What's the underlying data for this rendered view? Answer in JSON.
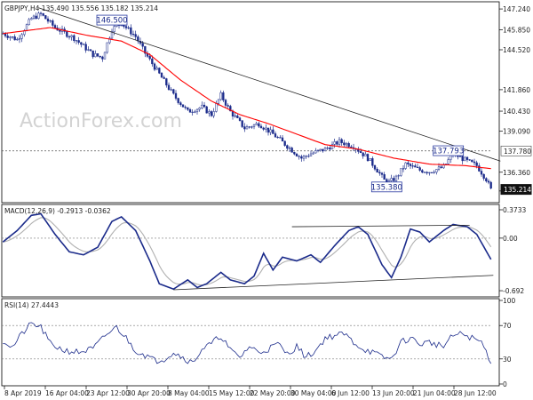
{
  "watermark": "ActionForex.com",
  "chart_data": [
    {
      "type": "candlestick",
      "panel": "price",
      "header": "GBPJPY,H4  135.490 135.556 135.182 135.214",
      "x_tick_labels": [
        "8 Apr 2019",
        "16 Apr 04:00",
        "23 Apr 12:00",
        "30 Apr 20:00",
        "8 May 04:00",
        "15 May 12:00",
        "22 May 20:00",
        "30 May 04:00",
        "6 Jun 12:00",
        "13 Jun 20:00",
        "21 Jun 04:00",
        "28 Jun 12:00"
      ],
      "y_tick_labels": [
        "147.240",
        "145.850",
        "144.520",
        "141.860",
        "140.430",
        "139.090",
        "136.360",
        "135.110"
      ],
      "y_ticks": [
        147.24,
        145.85,
        144.52,
        141.86,
        140.43,
        139.09,
        136.36,
        135.11
      ],
      "ylim": [
        134.45,
        147.6
      ],
      "last_price_label": "135.214",
      "last_price": 135.214,
      "level_label": "137.780",
      "level": 137.78,
      "callouts": [
        {
          "label": "146.500",
          "x_index": 46,
          "y": 146.5
        },
        {
          "label": "137.793",
          "x_index": 188,
          "y": 137.793
        },
        {
          "label": "135.380",
          "x_index": 162,
          "y": 135.38
        }
      ],
      "trendline": {
        "from": [
          15,
          147.32
        ],
        "to": [
          210,
          137.1
        ]
      },
      "ma_line_color": "#ff0000",
      "candle_color": "#1a2a8a",
      "price_anchors": [
        [
          0,
          145.6
        ],
        [
          6,
          145.2
        ],
        [
          12,
          146.6
        ],
        [
          16,
          146.9
        ],
        [
          22,
          146.0
        ],
        [
          30,
          145.3
        ],
        [
          38,
          144.2
        ],
        [
          42,
          144.0
        ],
        [
          46,
          145.9
        ],
        [
          50,
          146.3
        ],
        [
          56,
          145.4
        ],
        [
          60,
          144.3
        ],
        [
          66,
          142.9
        ],
        [
          72,
          141.5
        ],
        [
          78,
          140.4
        ],
        [
          84,
          140.7
        ],
        [
          88,
          140.2
        ],
        [
          92,
          141.5
        ],
        [
          96,
          140.4
        ],
        [
          102,
          139.3
        ],
        [
          108,
          139.6
        ],
        [
          114,
          138.9
        ],
        [
          120,
          138.1
        ],
        [
          126,
          137.3
        ],
        [
          130,
          137.6
        ],
        [
          136,
          137.9
        ],
        [
          142,
          138.4
        ],
        [
          148,
          138.1
        ],
        [
          154,
          137.3
        ],
        [
          158,
          136.5
        ],
        [
          162,
          135.6
        ],
        [
          166,
          136.0
        ],
        [
          170,
          136.9
        ],
        [
          176,
          136.5
        ],
        [
          180,
          136.4
        ],
        [
          186,
          136.7
        ],
        [
          190,
          137.6
        ],
        [
          196,
          137.1
        ],
        [
          200,
          136.8
        ],
        [
          204,
          135.9
        ],
        [
          206,
          135.2
        ]
      ],
      "ma_anchors": [
        [
          0,
          145.6
        ],
        [
          20,
          146.0
        ],
        [
          35,
          145.5
        ],
        [
          50,
          145.1
        ],
        [
          62,
          144.2
        ],
        [
          75,
          142.5
        ],
        [
          88,
          141.1
        ],
        [
          100,
          140.2
        ],
        [
          112,
          139.6
        ],
        [
          124,
          138.9
        ],
        [
          136,
          138.2
        ],
        [
          150,
          137.9
        ],
        [
          165,
          137.3
        ],
        [
          180,
          136.9
        ],
        [
          195,
          136.8
        ],
        [
          206,
          136.6
        ]
      ],
      "n_candles": 207
    },
    {
      "type": "line",
      "panel": "macd",
      "header": "MACD(12,26,9) -0.2913 -0.0362",
      "y_tick_labels": [
        "0.3733",
        "0.00",
        "-0.692"
      ],
      "y_ticks": [
        0.3733,
        0.0,
        -0.692
      ],
      "ylim": [
        -0.75,
        0.42
      ],
      "macd_color": "#1a2a8a",
      "signal_color": "#b0b0b0",
      "macd_anchors": [
        [
          0,
          -0.05
        ],
        [
          6,
          0.1
        ],
        [
          12,
          0.3
        ],
        [
          16,
          0.32
        ],
        [
          22,
          0.05
        ],
        [
          28,
          -0.18
        ],
        [
          34,
          -0.22
        ],
        [
          40,
          -0.12
        ],
        [
          46,
          0.22
        ],
        [
          50,
          0.28
        ],
        [
          56,
          0.1
        ],
        [
          62,
          -0.3
        ],
        [
          66,
          -0.6
        ],
        [
          72,
          -0.67
        ],
        [
          78,
          -0.55
        ],
        [
          82,
          -0.65
        ],
        [
          86,
          -0.6
        ],
        [
          92,
          -0.45
        ],
        [
          96,
          -0.55
        ],
        [
          102,
          -0.6
        ],
        [
          106,
          -0.5
        ],
        [
          110,
          -0.2
        ],
        [
          114,
          -0.42
        ],
        [
          118,
          -0.25
        ],
        [
          124,
          -0.3
        ],
        [
          130,
          -0.22
        ],
        [
          134,
          -0.32
        ],
        [
          140,
          -0.1
        ],
        [
          146,
          0.1
        ],
        [
          150,
          0.15
        ],
        [
          154,
          0.05
        ],
        [
          160,
          -0.35
        ],
        [
          164,
          -0.52
        ],
        [
          168,
          -0.25
        ],
        [
          172,
          0.12
        ],
        [
          176,
          0.08
        ],
        [
          180,
          -0.05
        ],
        [
          186,
          0.1
        ],
        [
          190,
          0.18
        ],
        [
          196,
          0.15
        ],
        [
          200,
          0.05
        ],
        [
          206,
          -0.28
        ]
      ],
      "trendlines": [
        {
          "from": [
            122,
            0.15
          ],
          "to": [
            197,
            0.17
          ]
        },
        {
          "from": [
            72,
            -0.68
          ],
          "to": [
            207,
            -0.49
          ]
        }
      ]
    },
    {
      "type": "line",
      "panel": "rsi",
      "header": "RSI(14) 27.4443",
      "y_tick_labels": [
        "100",
        "70",
        "30",
        "0"
      ],
      "y_ticks": [
        100,
        70,
        30,
        0
      ],
      "ylim": [
        0,
        100
      ],
      "rsi_color": "#1a2a8a",
      "rsi_anchors": [
        [
          0,
          52
        ],
        [
          4,
          44
        ],
        [
          8,
          60
        ],
        [
          12,
          72
        ],
        [
          16,
          68
        ],
        [
          20,
          48
        ],
        [
          26,
          40
        ],
        [
          32,
          38
        ],
        [
          38,
          42
        ],
        [
          44,
          60
        ],
        [
          48,
          68
        ],
        [
          52,
          55
        ],
        [
          56,
          40
        ],
        [
          60,
          35
        ],
        [
          64,
          28
        ],
        [
          68,
          30
        ],
        [
          72,
          38
        ],
        [
          76,
          32
        ],
        [
          80,
          25
        ],
        [
          84,
          42
        ],
        [
          88,
          48
        ],
        [
          92,
          58
        ],
        [
          96,
          40
        ],
        [
          100,
          32
        ],
        [
          104,
          45
        ],
        [
          108,
          38
        ],
        [
          112,
          42
        ],
        [
          116,
          48
        ],
        [
          120,
          36
        ],
        [
          124,
          45
        ],
        [
          128,
          32
        ],
        [
          132,
          40
        ],
        [
          136,
          55
        ],
        [
          140,
          58
        ],
        [
          144,
          60
        ],
        [
          148,
          50
        ],
        [
          152,
          42
        ],
        [
          156,
          38
        ],
        [
          160,
          32
        ],
        [
          164,
          30
        ],
        [
          168,
          50
        ],
        [
          172,
          55
        ],
        [
          176,
          48
        ],
        [
          180,
          50
        ],
        [
          186,
          45
        ],
        [
          190,
          58
        ],
        [
          194,
          60
        ],
        [
          198,
          55
        ],
        [
          202,
          50
        ],
        [
          206,
          27
        ]
      ]
    }
  ]
}
